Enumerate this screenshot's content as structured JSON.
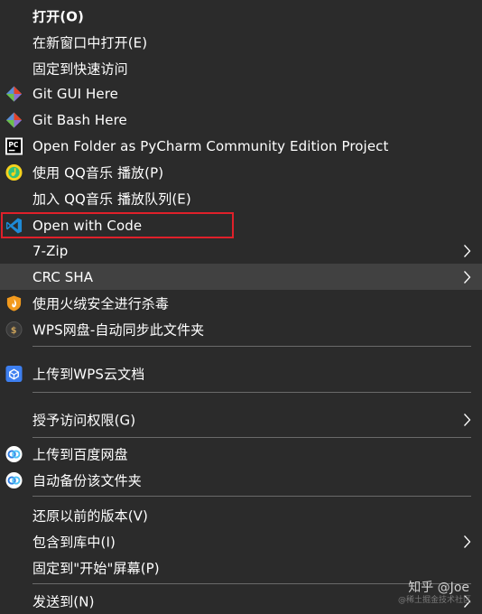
{
  "menu": {
    "items": [
      {
        "label": "打开(O)",
        "icon": "none"
      },
      {
        "label": "在新窗口中打开(E)",
        "icon": "none"
      },
      {
        "label": "固定到快速访问",
        "icon": "none"
      },
      {
        "label": "Git GUI Here",
        "icon": "git-icon"
      },
      {
        "label": "Git Bash Here",
        "icon": "git-icon"
      },
      {
        "label": "Open Folder as PyCharm Community Edition Project",
        "icon": "pycharm-icon"
      },
      {
        "label": "使用 QQ音乐 播放(P)",
        "icon": "qq-music-icon"
      },
      {
        "label": "加入 QQ音乐 播放队列(E)",
        "icon": "none"
      },
      {
        "label": "Open with Code",
        "icon": "vscode-icon"
      },
      {
        "label": "7-Zip",
        "icon": "none",
        "submenu": true
      },
      {
        "label": "CRC SHA",
        "icon": "none",
        "submenu": true
      },
      {
        "label": "使用火绒安全进行杀毒",
        "icon": "huorong-shield-icon"
      },
      {
        "label": "WPS网盘-自动同步此文件夹",
        "icon": "wps-drive-icon"
      },
      {
        "label": "上传到WPS云文档",
        "icon": "wps-cloud-icon"
      },
      {
        "label": "授予访问权限(G)",
        "icon": "none",
        "submenu": true
      },
      {
        "label": "上传到百度网盘",
        "icon": "baidu-netdisk-icon"
      },
      {
        "label": "自动备份该文件夹",
        "icon": "baidu-netdisk-icon"
      },
      {
        "label": "还原以前的版本(V)",
        "icon": "none"
      },
      {
        "label": "包含到库中(I)",
        "icon": "none",
        "submenu": true
      },
      {
        "label": "固定到\"开始\"屏幕(P)",
        "icon": "none"
      },
      {
        "label": "发送到(N)",
        "icon": "none",
        "submenu": true
      }
    ]
  },
  "watermark": {
    "text": "知乎 @Joe",
    "subtext": "@稀土掘金技术社区"
  },
  "colors": {
    "background": "#2b2b2b",
    "hover": "#414141",
    "highlight_border": "#e0202a",
    "separator": "#6a6a6a"
  }
}
